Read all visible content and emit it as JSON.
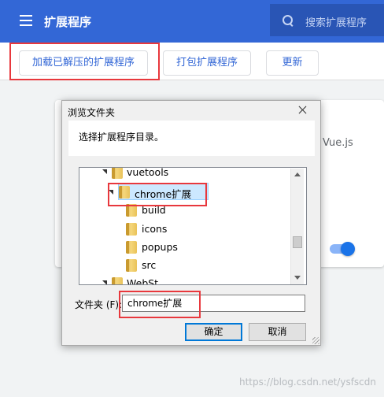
{
  "header": {
    "title": "扩展程序",
    "search_placeholder": "搜索扩展程序"
  },
  "toolbar": {
    "load_unpacked": "加载已解压的扩展程序",
    "pack_extension": "打包扩展程序",
    "update": "更新"
  },
  "background_card": {
    "text": "Vue.js"
  },
  "dialog": {
    "title": "浏览文件夹",
    "prompt": "选择扩展程序目录。",
    "tree": [
      {
        "label": "vuetools",
        "expanded": true
      },
      {
        "label": "chrome扩展",
        "expanded": true,
        "selected": true
      },
      {
        "label": "build"
      },
      {
        "label": "icons"
      },
      {
        "label": "popups"
      },
      {
        "label": "src"
      },
      {
        "label": "WebSt",
        "expanded": true
      }
    ],
    "folder_label": "文件夹 (F):",
    "folder_value": "chrome扩展",
    "ok": "确定",
    "cancel": "取消"
  },
  "watermark": "https://blog.csdn.net/ysfscdn",
  "colors": {
    "accent": "#3367d6",
    "highlight": "#e8383d"
  }
}
